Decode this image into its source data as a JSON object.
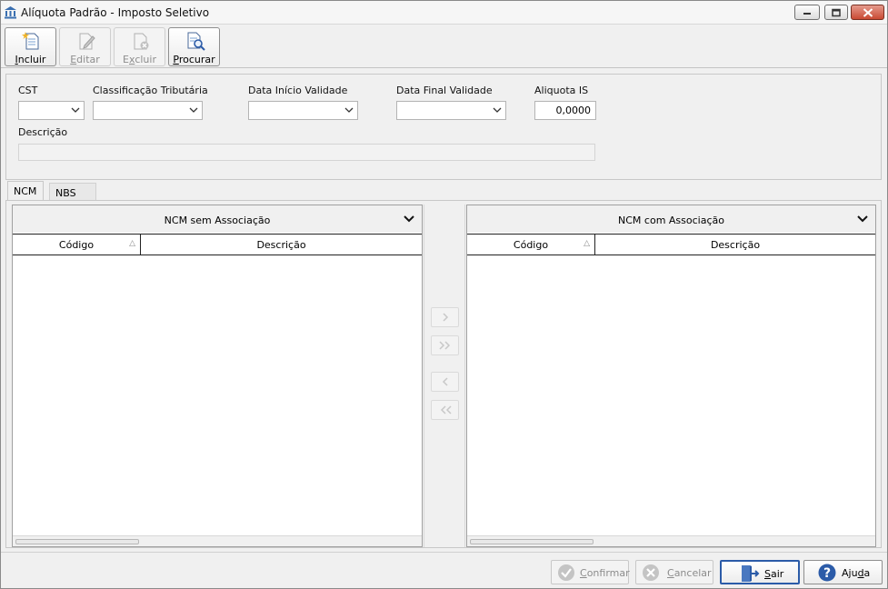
{
  "window": {
    "title": "Alíquota Padrão - Imposto Seletivo",
    "icon": "building-columns-icon",
    "controls": [
      "minimize-icon",
      "maximize-icon",
      "close-icon"
    ]
  },
  "toolbar": {
    "buttons": [
      {
        "label": "Incluir",
        "accel": "I",
        "rest": "ncluir",
        "icon": "new-document-icon",
        "enabled": true
      },
      {
        "label": "Editar",
        "accel": "E",
        "rest": "ditar",
        "icon": "edit-document-icon",
        "enabled": false
      },
      {
        "label": "Excluir",
        "accel": "x",
        "pre": "E",
        "rest": "cluir",
        "icon": "delete-document-icon",
        "enabled": false
      },
      {
        "label": "Procurar",
        "accel": "P",
        "rest": "rocurar",
        "icon": "search-document-icon",
        "enabled": true
      }
    ]
  },
  "filters": {
    "cst": {
      "label": "CST",
      "value": ""
    },
    "classificacao": {
      "label": "Classificação Tributária",
      "value": ""
    },
    "data_inicio": {
      "label": "Data Início Validade",
      "value": ""
    },
    "data_final": {
      "label": "Data Final Validade",
      "value": ""
    },
    "aliquota": {
      "label": "Aliquota IS",
      "value": "0,0000"
    },
    "descricao": {
      "label": "Descrição",
      "value": ""
    }
  },
  "tabs": [
    {
      "label": "NCM",
      "selected": true
    },
    {
      "label": "NBS",
      "selected": false
    }
  ],
  "grids": {
    "left": {
      "title": "NCM sem Associação",
      "columns": [
        "Código",
        "Descrição"
      ],
      "rows": []
    },
    "right": {
      "title": "NCM com Associação",
      "columns": [
        "Código",
        "Descrição"
      ],
      "rows": []
    }
  },
  "transfer_buttons": [
    "move-right-icon",
    "move-all-right-icon",
    "move-left-icon",
    "move-all-left-icon"
  ],
  "footer": {
    "buttons": [
      {
        "label": "Confirmar",
        "pre": "",
        "accel": "C",
        "rest": "onfirmar",
        "icon": "check-circle-icon",
        "enabled": false
      },
      {
        "label": "Cancelar",
        "pre": "",
        "accel": "C",
        "rest": "ancelar",
        "icon": "x-circle-icon",
        "enabled": false
      },
      {
        "label": "Sair",
        "pre": "",
        "accel": "S",
        "rest": "air",
        "icon": "exit-door-icon",
        "enabled": true
      },
      {
        "label": "Ajuda",
        "pre": "Aju",
        "accel": "d",
        "rest": "a",
        "icon": "help-circle-icon",
        "enabled": true
      }
    ]
  },
  "colors": {
    "window_bg": "#f0f0f0",
    "close_button": "#c94a33",
    "accent_blue": "#2b5ba8"
  }
}
